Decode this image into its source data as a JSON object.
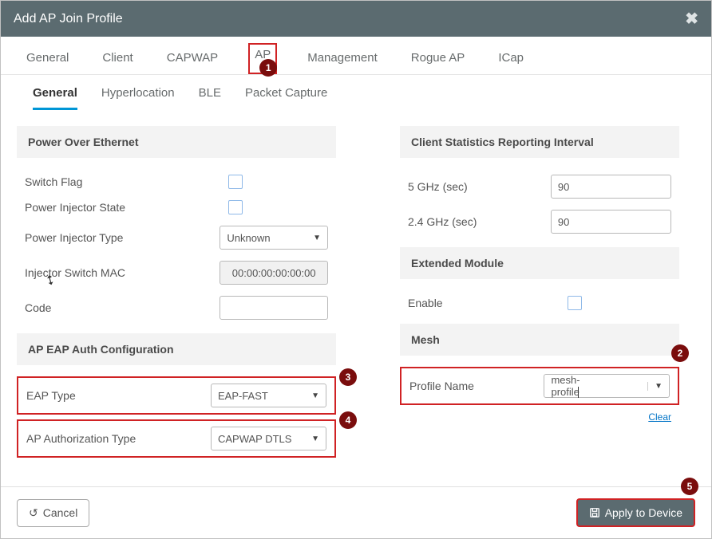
{
  "title": "Add AP Join Profile",
  "tabs": [
    "General",
    "Client",
    "CAPWAP",
    "AP",
    "Management",
    "Rogue AP",
    "ICap"
  ],
  "subtabs": [
    "General",
    "Hyperlocation",
    "BLE",
    "Packet Capture"
  ],
  "sections": {
    "poe": {
      "header": "Power Over Ethernet",
      "switch_flag_label": "Switch Flag",
      "pis_label": "Power Injector State",
      "pit_label": "Power Injector Type",
      "pit_value": "Unknown",
      "ism_label": "Injector Switch MAC",
      "ism_value": "00:00:00:00:00:00",
      "code_label": "Code",
      "code_value": ""
    },
    "eap": {
      "header": "AP EAP Auth Configuration",
      "eap_type_label": "EAP Type",
      "eap_type_value": "EAP-FAST",
      "auth_type_label": "AP Authorization Type",
      "auth_type_value": "CAPWAP DTLS"
    },
    "csr": {
      "header": "Client Statistics Reporting Interval",
      "ghz5_label": "5 GHz (sec)",
      "ghz5_value": "90",
      "ghz24_label": "2.4 GHz (sec)",
      "ghz24_value": "90"
    },
    "ext": {
      "header": "Extended Module",
      "enable_label": "Enable"
    },
    "mesh": {
      "header": "Mesh",
      "profile_label": "Profile Name",
      "profile_value": "mesh-profile",
      "clear": "Clear"
    }
  },
  "footer": {
    "cancel": "Cancel",
    "apply": "Apply to Device"
  },
  "badges": {
    "b1": "1",
    "b2": "2",
    "b3": "3",
    "b4": "4",
    "b5": "5"
  }
}
